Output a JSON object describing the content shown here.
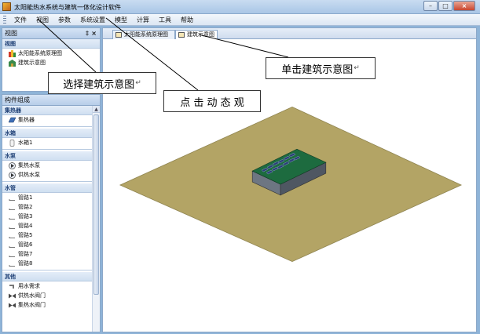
{
  "window": {
    "title": "太阳能热水系统与建筑一体化设计软件",
    "btn_min": "–",
    "btn_max": "□",
    "btn_close": "×"
  },
  "menu": [
    "文件",
    "视图",
    "参数",
    "系统设置",
    "模型",
    "计算",
    "工具",
    "帮助"
  ],
  "view_panel": {
    "title": "视图",
    "pin": "‡",
    "close": "×",
    "section": "视图",
    "items": [
      "太阳能系统原理图",
      "建筑示意图"
    ]
  },
  "component_panel": {
    "title": "构件组成",
    "groups": [
      {
        "name": "集热器",
        "items": [
          "集热器"
        ]
      },
      {
        "name": "水箱",
        "items": [
          "水箱1"
        ]
      },
      {
        "name": "水泵",
        "items": [
          "集热水泵",
          "供热水泵"
        ]
      },
      {
        "name": "水管",
        "items": [
          "管路1",
          "管路2",
          "管路3",
          "管路4",
          "管路5",
          "管路6",
          "管路7",
          "管路8"
        ]
      },
      {
        "name": "其他",
        "items": [
          "用水需求",
          "供热水阀门",
          "集热水阀门"
        ]
      }
    ]
  },
  "tabs": [
    "太阳能系统原理图",
    "建筑示意图"
  ],
  "callouts": {
    "select": "选择建筑示意图",
    "dynamic": "点 击 动 态 观",
    "click": "单击建筑示意图",
    "return_mark": "↵"
  },
  "colors": {
    "ground": "#b3a465",
    "roof": "#1d6b3f",
    "building_side": "#5b6470",
    "panel": "#2c3f78"
  }
}
